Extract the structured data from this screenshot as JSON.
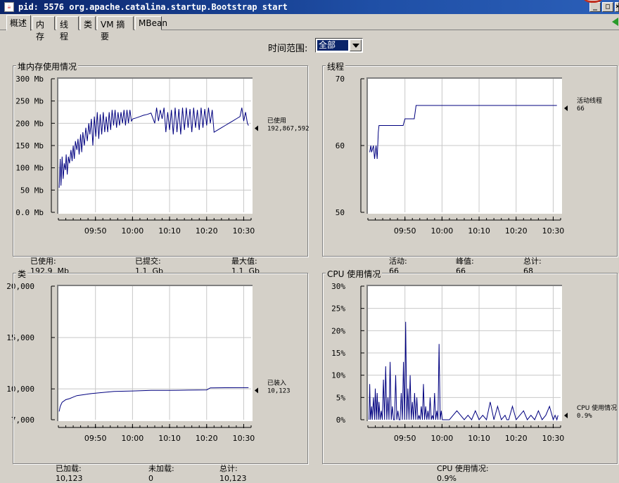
{
  "window": {
    "title": "pid: 5576 org.apache.catalina.startup.Bootstrap start",
    "buttons": [
      "_",
      "□",
      "×"
    ]
  },
  "tabs": [
    {
      "label": "概述",
      "active": true
    },
    {
      "label": "内存"
    },
    {
      "label": "线程"
    },
    {
      "label": "类"
    },
    {
      "label": "VM 摘要"
    },
    {
      "label": "MBean"
    }
  ],
  "time_range": {
    "label": "时间范围:",
    "value": "全部"
  },
  "colors": {
    "line": "#00007f",
    "grid": "#c8c8c8",
    "plot_bg": "#ffffff",
    "bg": "#d4d0c8"
  },
  "panels": {
    "heap": {
      "title": "堆内存使用情况",
      "footer": [
        {
          "label": "已使用:",
          "value": "192.9  Mb"
        },
        {
          "label": "已提交:",
          "value": "1.1  Gb"
        },
        {
          "label": "最大值:",
          "value": "1.1  Gb"
        }
      ]
    },
    "threads": {
      "title": "线程",
      "footer": [
        {
          "label": "活动:",
          "value": "66"
        },
        {
          "label": "峰值:",
          "value": "66"
        },
        {
          "label": "总计:",
          "value": "68"
        }
      ]
    },
    "classes": {
      "title": "类",
      "footer": [
        {
          "label": "已加载:",
          "value": "10,123"
        },
        {
          "label": "未加载:",
          "value": "0"
        },
        {
          "label": "总计:",
          "value": "10,123"
        }
      ]
    },
    "cpu": {
      "title": "CPU 使用情况",
      "footer": [
        {
          "label": "CPU 使用情况:",
          "value": "0.9%"
        }
      ]
    }
  },
  "chart_data": [
    {
      "id": "heap",
      "type": "line",
      "ylim": [
        0,
        300
      ],
      "yticks": [
        {
          "v": 0,
          "label": "0.0 Mb"
        },
        {
          "v": 50,
          "label": "50 Mb"
        },
        {
          "v": 100,
          "label": "100 Mb"
        },
        {
          "v": 150,
          "label": "150 Mb"
        },
        {
          "v": 200,
          "label": "200 Mb"
        },
        {
          "v": 250,
          "label": "250 Mb"
        },
        {
          "v": 300,
          "label": "300 Mb"
        }
      ],
      "xlim": [
        0,
        52
      ],
      "xticks": [
        {
          "v": 10,
          "label": "09:50"
        },
        {
          "v": 20,
          "label": "10:00"
        },
        {
          "v": 30,
          "label": "10:10"
        },
        {
          "v": 40,
          "label": "10:20"
        },
        {
          "v": 50,
          "label": "10:30"
        }
      ],
      "legend": {
        "name": "已使用",
        "value": "192,867,592"
      },
      "series": [
        {
          "name": "已使用",
          "x": [
            0.2,
            0.5,
            0.7,
            1.0,
            1.3,
            1.6,
            1.9,
            2.1,
            2.4,
            2.7,
            3.0,
            3.4,
            3.7,
            4.0,
            4.3,
            4.6,
            5.0,
            5.3,
            5.6,
            6.0,
            6.3,
            6.6,
            7.0,
            7.4,
            7.8,
            8.2,
            8.5,
            8.9,
            9.3,
            9.7,
            10.1,
            10.5,
            10.9,
            11.3,
            11.7,
            12.1,
            12.5,
            12.9,
            13.3,
            13.7,
            14.1,
            14.5,
            14.9,
            15.3,
            15.7,
            16.1,
            16.5,
            16.9,
            17.3,
            17.7,
            18.1,
            18.5,
            18.9,
            19.3,
            19.7,
            20.1,
            21.0,
            22.0,
            23.0,
            24.0,
            25.0,
            26.0,
            26.5,
            27.0,
            27.5,
            28.0,
            28.5,
            29.0,
            29.5,
            30.0,
            30.5,
            31.0,
            31.5,
            32.0,
            32.5,
            33.0,
            33.5,
            34.0,
            34.5,
            35.0,
            35.5,
            36.0,
            36.5,
            37.0,
            37.5,
            38.0,
            38.5,
            39.0,
            39.5,
            40.0,
            40.5,
            41.0,
            41.5,
            42.0,
            43.0,
            44.0,
            45.0,
            46.0,
            47.0,
            48.0,
            49.0,
            49.5,
            50.0,
            50.5,
            51.0,
            51.3
          ],
          "y": [
            55,
            120,
            60,
            125,
            75,
            110,
            95,
            130,
            85,
            125,
            110,
            140,
            115,
            150,
            120,
            160,
            140,
            165,
            130,
            175,
            135,
            180,
            150,
            190,
            160,
            200,
            175,
            210,
            150,
            215,
            170,
            225,
            165,
            220,
            175,
            225,
            180,
            215,
            180,
            225,
            185,
            230,
            195,
            230,
            190,
            225,
            195,
            225,
            200,
            230,
            195,
            230,
            200,
            230,
            205,
            210,
            212,
            215,
            218,
            220,
            223,
            200,
            235,
            205,
            230,
            210,
            235,
            180,
            225,
            185,
            230,
            175,
            235,
            180,
            232,
            175,
            235,
            185,
            235,
            190,
            232,
            180,
            235,
            190,
            230,
            185,
            235,
            190,
            232,
            195,
            235,
            200,
            230,
            180,
            185,
            190,
            195,
            200,
            205,
            210,
            215,
            235,
            205,
            225,
            200,
            195
          ]
        }
      ]
    },
    {
      "id": "threads",
      "type": "line",
      "ylim": [
        50,
        70
      ],
      "yticks": [
        {
          "v": 50,
          "label": "50"
        },
        {
          "v": 60,
          "label": "60"
        },
        {
          "v": 70,
          "label": "70"
        }
      ],
      "xlim": [
        0,
        52
      ],
      "xticks": [
        {
          "v": 10,
          "label": "09:50"
        },
        {
          "v": 20,
          "label": "10:00"
        },
        {
          "v": 30,
          "label": "10:10"
        },
        {
          "v": 40,
          "label": "10:20"
        },
        {
          "v": 50,
          "label": "10:30"
        }
      ],
      "legend": {
        "name": "活动线程",
        "value": "66"
      },
      "series": [
        {
          "name": "活动线程",
          "x": [
            0.5,
            0.8,
            1.0,
            1.5,
            1.8,
            2.2,
            2.5,
            2.8,
            3.0,
            3.5,
            9.5,
            10.0,
            12.5,
            13.0,
            51.0
          ],
          "y": [
            59,
            60,
            59,
            60,
            58,
            60,
            58,
            62,
            63,
            63,
            63,
            64,
            64,
            66,
            66
          ]
        }
      ]
    },
    {
      "id": "classes",
      "type": "line",
      "ylim": [
        7000,
        20000
      ],
      "yticks": [
        {
          "v": 7000,
          "label": "7,000"
        },
        {
          "v": 10000,
          "label": "10,000"
        },
        {
          "v": 15000,
          "label": "15,000"
        },
        {
          "v": 20000,
          "label": "20,000"
        }
      ],
      "xlim": [
        0,
        52
      ],
      "xticks": [
        {
          "v": 10,
          "label": "09:50"
        },
        {
          "v": 20,
          "label": "10:00"
        },
        {
          "v": 30,
          "label": "10:10"
        },
        {
          "v": 40,
          "label": "10:20"
        },
        {
          "v": 50,
          "label": "10:30"
        }
      ],
      "legend": {
        "name": "已装入",
        "value": "10,123"
      },
      "series": [
        {
          "name": "已装入",
          "x": [
            0.2,
            0.5,
            1.0,
            2.0,
            3.0,
            4.0,
            5.0,
            7.0,
            9.0,
            12.0,
            15.0,
            20.0,
            25.0,
            30.0,
            35.0,
            40.0,
            41.0,
            45.0,
            51.3
          ],
          "y": [
            7800,
            8300,
            8700,
            8950,
            9050,
            9200,
            9350,
            9450,
            9550,
            9650,
            9750,
            9800,
            9850,
            9850,
            9880,
            9900,
            10100,
            10110,
            10123
          ]
        }
      ]
    },
    {
      "id": "cpu",
      "type": "line",
      "ylim": [
        0,
        30
      ],
      "yticks": [
        {
          "v": 0,
          "label": "0%"
        },
        {
          "v": 5,
          "label": "5%"
        },
        {
          "v": 10,
          "label": "10%"
        },
        {
          "v": 15,
          "label": "15%"
        },
        {
          "v": 20,
          "label": "20%"
        },
        {
          "v": 25,
          "label": "25%"
        },
        {
          "v": 30,
          "label": "30%"
        }
      ],
      "xlim": [
        0,
        52
      ],
      "xticks": [
        {
          "v": 10,
          "label": "09:50"
        },
        {
          "v": 20,
          "label": "10:00"
        },
        {
          "v": 30,
          "label": "10:10"
        },
        {
          "v": 40,
          "label": "10:20"
        },
        {
          "v": 50,
          "label": "10:30"
        }
      ],
      "legend": {
        "name": "CPU 使用情况",
        "value": "0.9%"
      },
      "series": [
        {
          "name": "CPU 使用情况",
          "x": [
            0.3,
            0.5,
            0.7,
            1.0,
            1.2,
            1.5,
            1.8,
            2.0,
            2.3,
            2.5,
            2.8,
            3.0,
            3.3,
            3.6,
            3.9,
            4.2,
            4.5,
            4.8,
            5.1,
            5.4,
            5.7,
            6.0,
            6.3,
            6.6,
            6.9,
            7.2,
            7.5,
            7.8,
            8.1,
            8.4,
            8.7,
            9.0,
            9.3,
            9.6,
            9.9,
            10.2,
            10.5,
            10.8,
            11.1,
            11.4,
            11.7,
            12.0,
            12.3,
            12.6,
            12.9,
            13.2,
            13.5,
            13.8,
            14.1,
            14.4,
            14.7,
            15.0,
            15.3,
            15.6,
            15.9,
            16.2,
            16.5,
            16.8,
            17.1,
            17.4,
            17.7,
            18.0,
            18.3,
            18.6,
            18.9,
            19.2,
            19.5,
            19.8,
            20.1,
            22,
            24,
            26,
            27,
            28,
            29,
            30,
            31,
            32,
            33,
            34,
            35,
            36,
            37,
            37.5,
            38,
            39,
            40,
            41,
            42,
            43,
            44,
            45,
            46,
            47,
            48,
            49,
            50,
            50.5,
            51,
            51.3
          ],
          "y": [
            0,
            8,
            0,
            3,
            0,
            5,
            0,
            7,
            0,
            6,
            0,
            4,
            0,
            2,
            0,
            9,
            0,
            12,
            0,
            5,
            0,
            13,
            0,
            3,
            0,
            0,
            10,
            0,
            2,
            0,
            0,
            6,
            0,
            13,
            0,
            22,
            0,
            7,
            0,
            10,
            0,
            4,
            0,
            6,
            0,
            5,
            0,
            1,
            0,
            3,
            0,
            8,
            0,
            3,
            0,
            2,
            0,
            5,
            0,
            1,
            0,
            6,
            0,
            2,
            0,
            17,
            0,
            2,
            0,
            0,
            2,
            0,
            1,
            0,
            2,
            0,
            1,
            0,
            4,
            0,
            3,
            0,
            1,
            0,
            0,
            3,
            0,
            1,
            2,
            0,
            1,
            0,
            2,
            0,
            1,
            3,
            0,
            1,
            0,
            1
          ]
        }
      ]
    }
  ]
}
